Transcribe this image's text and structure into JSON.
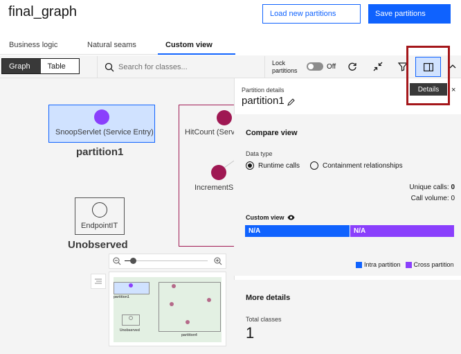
{
  "header": {
    "title": "final_graph",
    "load_button": "Load new partitions",
    "save_button": "Save partitions"
  },
  "tabs": [
    {
      "label": "Business logic"
    },
    {
      "label": "Natural seams"
    },
    {
      "label": "Custom view",
      "active": true
    }
  ],
  "toolbar": {
    "view_toggle": [
      "Graph",
      "Table"
    ],
    "search_placeholder": "Search for classes...",
    "lock_label_1": "Lock",
    "lock_label_2": "partitions",
    "lock_state": "Off",
    "tooltip": "Details"
  },
  "canvas": {
    "partition1": {
      "node_label": "SnoopServlet (Service Entry)",
      "label": "partition1"
    },
    "partition2": {
      "node1": "HitCount (Serv",
      "node2": "IncrementS"
    },
    "unobserved": {
      "node_label": "EndpointIT",
      "label": "Unobserved"
    },
    "minimap": {
      "label1": "partition1",
      "label2": "Unobserved",
      "label3": "partition4"
    }
  },
  "panel": {
    "small_title": "Partition details",
    "title": "partition1",
    "compare_heading": "Compare view",
    "data_type_label": "Data type",
    "radio_runtime": "Runtime calls",
    "radio_containment": "Containment relationships",
    "unique_calls_label": "Unique calls:",
    "unique_calls_value": "0",
    "call_volume_label": "Call volume:",
    "call_volume_value": "0",
    "custom_view_label": "Custom view",
    "bar_left": "N/A",
    "bar_right": "N/A",
    "legend_intra": "Intra partition",
    "legend_cross": "Cross partition",
    "more_heading": "More details",
    "total_classes_label": "Total classes",
    "total_classes_value": "1"
  },
  "colors": {
    "accent": "#0f62fe",
    "purple": "#8a3ffc",
    "magenta": "#9f1853",
    "highlight": "#a4161a"
  }
}
